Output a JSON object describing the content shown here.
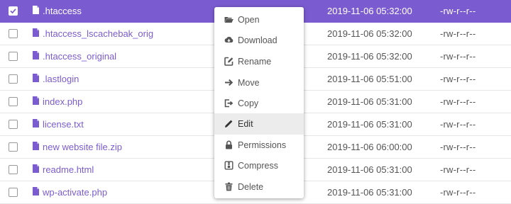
{
  "files": [
    {
      "name": ".htaccess",
      "date": "2019-11-06 05:32:00",
      "permissions": "-rw-r--r--",
      "selected": true
    },
    {
      "name": ".htaccess_lscachebak_orig",
      "date": "2019-11-06 05:32:00",
      "permissions": "-rw-r--r--",
      "selected": false
    },
    {
      "name": ".htaccess_original",
      "date": "2019-11-06 05:32:00",
      "permissions": "-rw-r--r--",
      "selected": false
    },
    {
      "name": ".lastlogin",
      "date": "2019-11-06 05:51:00",
      "permissions": "-rw-r--r--",
      "selected": false
    },
    {
      "name": "index.php",
      "date": "2019-11-06 05:31:00",
      "permissions": "-rw-r--r--",
      "selected": false
    },
    {
      "name": "license.txt",
      "date": "2019-11-06 05:31:00",
      "permissions": "-rw-r--r--",
      "selected": false
    },
    {
      "name": "new website file.zip",
      "date": "2019-11-06 06:00:00",
      "permissions": "-rw-r--r--",
      "selected": false
    },
    {
      "name": "readme.html",
      "date": "2019-11-06 05:31:00",
      "permissions": "-rw-r--r--",
      "selected": false
    },
    {
      "name": "wp-activate.php",
      "date": "2019-11-06 05:31:00",
      "permissions": "-rw-r--r--",
      "selected": false
    }
  ],
  "context_menu": {
    "items": [
      {
        "label": "Open",
        "icon": "folder-open-icon"
      },
      {
        "label": "Download",
        "icon": "cloud-download-icon"
      },
      {
        "label": "Rename",
        "icon": "rename-icon"
      },
      {
        "label": "Move",
        "icon": "arrow-right-icon"
      },
      {
        "label": "Copy",
        "icon": "copy-icon"
      },
      {
        "label": "Edit",
        "icon": "pencil-icon",
        "active": true
      },
      {
        "label": "Permissions",
        "icon": "lock-icon"
      },
      {
        "label": "Compress",
        "icon": "archive-icon"
      },
      {
        "label": "Delete",
        "icon": "trash-icon"
      }
    ]
  },
  "colors": {
    "accent": "#7b5cd0",
    "row_border": "#e6e6e6",
    "menu_hover": "#ececec",
    "text": "#555555"
  }
}
